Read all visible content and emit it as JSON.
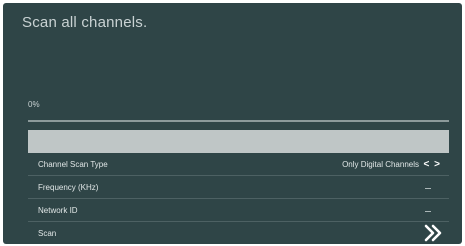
{
  "screen": {
    "title": "Scan all channels.",
    "progress": {
      "text": "0%",
      "value_percent": 0
    }
  },
  "rows": [
    {
      "label": "",
      "value": ""
    },
    {
      "label": "Channel Scan Type",
      "value": "Only Digital Channels",
      "control_icon": "left-right-arrows-icon"
    },
    {
      "label": "Frequency (KHz)",
      "value": "_"
    },
    {
      "label": "Network ID",
      "value": "_"
    },
    {
      "label": "Scan",
      "control_icon": "double-chevron-right-icon"
    }
  ],
  "colors": {
    "background": "#2f4547",
    "highlight": "#bfc6c6",
    "text": "#e1e7e7"
  }
}
